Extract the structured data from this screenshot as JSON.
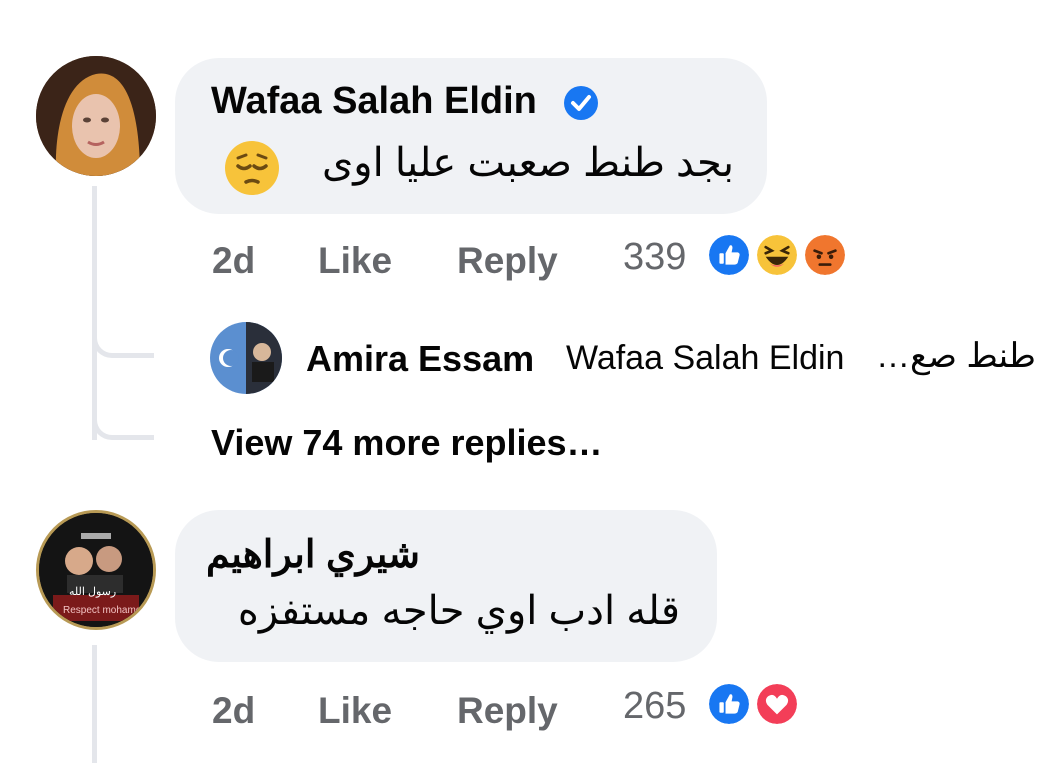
{
  "comments": [
    {
      "author": "Wafaa Salah Eldin",
      "verified": true,
      "text": "بجد طنط صعبت عليا اوى",
      "emoji_icon": "pensive-face-icon",
      "time": "2d",
      "like_label": "Like",
      "reply_label": "Reply",
      "reaction_count": "339",
      "reactions": [
        "like-icon",
        "haha-icon",
        "angry-icon"
      ],
      "reply_preview": {
        "author": "Amira Essam",
        "mention": "Wafaa Salah Eldin",
        "text": "طنط صع…"
      },
      "view_more": "View 74 more replies…"
    },
    {
      "author": "شيري ابراهيم",
      "text": "قله ادب اوي حاجه مستفزه",
      "time": "2d",
      "like_label": "Like",
      "reply_label": "Reply",
      "reaction_count": "265",
      "reactions": [
        "like-icon",
        "love-icon"
      ],
      "avatar_overlay": [
        "رسول الله",
        "Respect mohamed"
      ]
    }
  ],
  "colors": {
    "bubble": "#f0f2f5",
    "secondary_text": "#65676b",
    "like_blue": "#1877f2",
    "love_red": "#f33e58",
    "verified_blue": "#1877f2",
    "thread_line": "#e4e6eb"
  }
}
